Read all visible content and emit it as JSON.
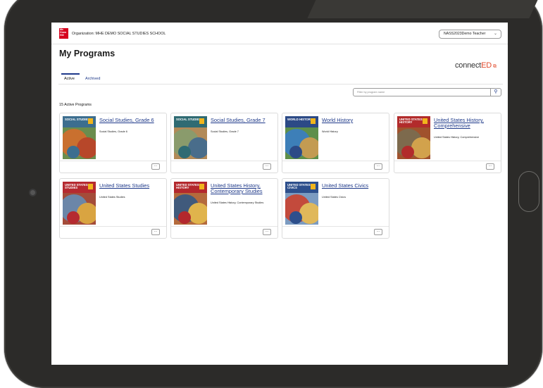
{
  "header": {
    "logo_text": "Mc Graw Hill",
    "organization": "Organization: MHE DEMO SOCIAL STUDIES SCHOOL",
    "user_menu_label": "NASS2023Demo Teacher",
    "user_menu_icon": "chevron-down-icon"
  },
  "page": {
    "title": "My Programs",
    "brand_part1": "connect",
    "brand_part2": "ED",
    "brand_icon": "external-link-icon"
  },
  "tabs": [
    {
      "label": "Active",
      "selected": true
    },
    {
      "label": "Archived",
      "selected": false
    }
  ],
  "filter": {
    "placeholder": "Filter by program name",
    "button_icon": "search-icon"
  },
  "count_label": "15 Active Programs",
  "more_label": "···",
  "programs": [
    {
      "title": "Social Studies, Grade 6",
      "subtitle": "Social Studies, Grade 6",
      "cover_title": "SOCIAL STUDIES",
      "colors": {
        "band": "#3c6e8f",
        "a": "#c9702f",
        "b": "#6a8d4e",
        "c": "#b7472a"
      }
    },
    {
      "title": "Social Studies, Grade 7",
      "subtitle": "Social Studies, Grade 7",
      "cover_title": "SOCIAL STUDIES",
      "colors": {
        "band": "#2f6b73",
        "a": "#8a9b6c",
        "b": "#b28a58",
        "c": "#496d8b"
      }
    },
    {
      "title": "World History",
      "subtitle": "World History",
      "cover_title": "WORLD HISTORY",
      "colors": {
        "band": "#2c4a86",
        "a": "#3d7fb8",
        "b": "#5e8f4a",
        "c": "#c39b52"
      }
    },
    {
      "title": "United States History, Comprehensive",
      "subtitle": "United States History, Comprehensive",
      "cover_title": "UNITED STATES HISTORY",
      "colors": {
        "band": "#b22b2b",
        "a": "#7d6a4d",
        "b": "#a0522d",
        "c": "#d2a24c"
      }
    },
    {
      "title": "United States Studies",
      "subtitle": "United States Studies",
      "cover_title": "UNITED STATES STUDIES",
      "colors": {
        "band": "#b52a30",
        "a": "#6b86a8",
        "b": "#a44c3a",
        "c": "#d9a441"
      }
    },
    {
      "title": "United States History, Contemporary Studies",
      "subtitle": "United States History, Contemporary Studies",
      "cover_title": "UNITED STATES HISTORY",
      "colors": {
        "band": "#b3282d",
        "a": "#405a7c",
        "b": "#b46a3c",
        "c": "#e0b44c"
      }
    },
    {
      "title": "United States Civics",
      "subtitle": "United States Civics",
      "cover_title": "UNITED STATES CIVICS",
      "colors": {
        "band": "#2d4f8c",
        "a": "#c34a3c",
        "b": "#7b9bc1",
        "c": "#e0b85a"
      }
    }
  ]
}
